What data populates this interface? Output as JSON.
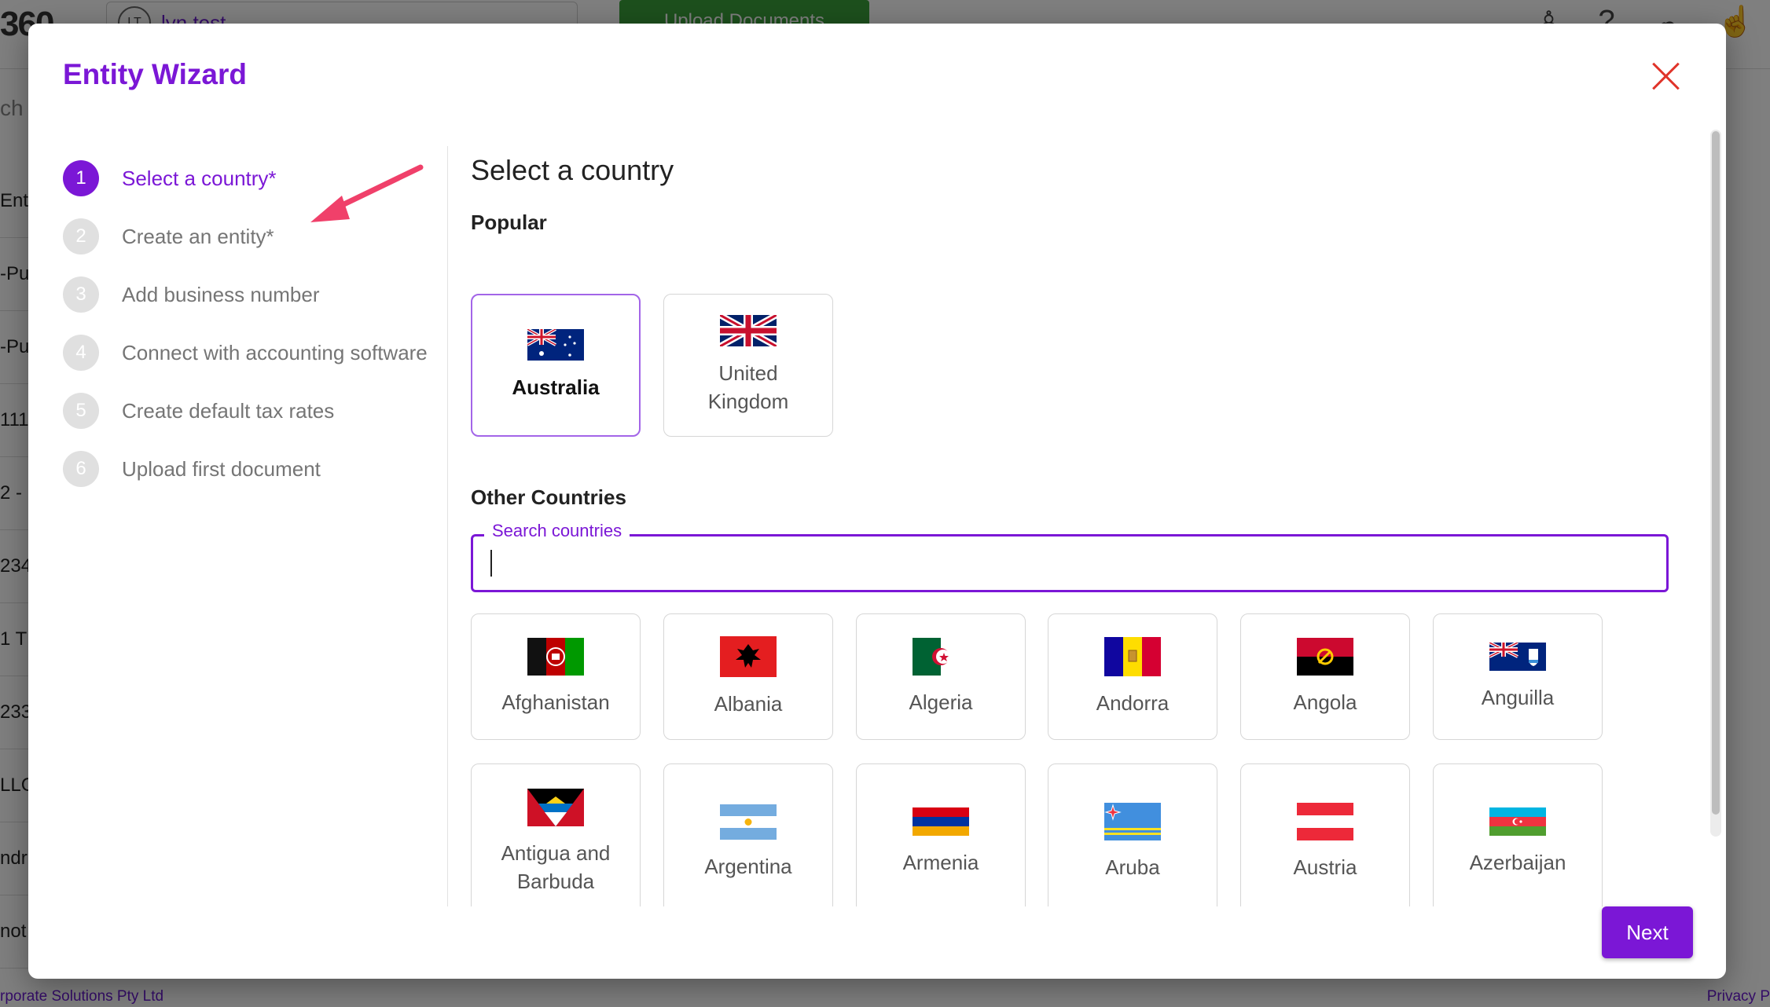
{
  "background": {
    "logo": "360",
    "entity_initials": "LT",
    "entity_name": "lyn test",
    "upload_button": "Upload Documents",
    "search_partial": "ch",
    "rows": [
      "Entiti",
      "-Pu",
      "-Pu",
      "111",
      "2 -",
      "234",
      "1 T",
      "233",
      "LLC",
      "ndr",
      "not"
    ],
    "footer_left": "rporate Solutions Pty Ltd",
    "footer_right": "Privacy P"
  },
  "modal": {
    "title": "Entity Wizard",
    "close_icon": "close-icon",
    "next_label": "Next"
  },
  "steps": [
    {
      "num": "1",
      "label": "Select a country*",
      "active": true
    },
    {
      "num": "2",
      "label": "Create an entity*",
      "active": false
    },
    {
      "num": "3",
      "label": "Add business number",
      "active": false
    },
    {
      "num": "4",
      "label": "Connect with accounting software",
      "active": false
    },
    {
      "num": "5",
      "label": "Create default tax rates",
      "active": false
    },
    {
      "num": "6",
      "label": "Upload first document",
      "active": false
    }
  ],
  "content": {
    "title": "Select a country",
    "popular_label": "Popular",
    "popular": [
      {
        "name": "Australia",
        "flag": "australia-flag",
        "selected": true
      },
      {
        "name": "United Kingdom",
        "flag": "united-kingdom-flag",
        "selected": false
      }
    ],
    "other_label": "Other Countries",
    "search_label": "Search countries",
    "search_value": "",
    "countries": [
      {
        "name": "Afghanistan",
        "flag": "afghanistan-flag"
      },
      {
        "name": "Albania",
        "flag": "albania-flag"
      },
      {
        "name": "Algeria",
        "flag": "algeria-flag"
      },
      {
        "name": "Andorra",
        "flag": "andorra-flag"
      },
      {
        "name": "Angola",
        "flag": "angola-flag"
      },
      {
        "name": "Anguilla",
        "flag": "anguilla-flag"
      },
      {
        "name": "Antigua and Barbuda",
        "flag": "antigua-and-barbuda-flag"
      },
      {
        "name": "Argentina",
        "flag": "argentina-flag"
      },
      {
        "name": "Armenia",
        "flag": "armenia-flag"
      },
      {
        "name": "Aruba",
        "flag": "aruba-flag"
      },
      {
        "name": "Austria",
        "flag": "austria-flag"
      },
      {
        "name": "Azerbaijan",
        "flag": "azerbaijan-flag"
      }
    ]
  },
  "colors": {
    "accent": "#7b17d6",
    "close": "#e0342a",
    "annotation_arrow": "#f0406a"
  }
}
